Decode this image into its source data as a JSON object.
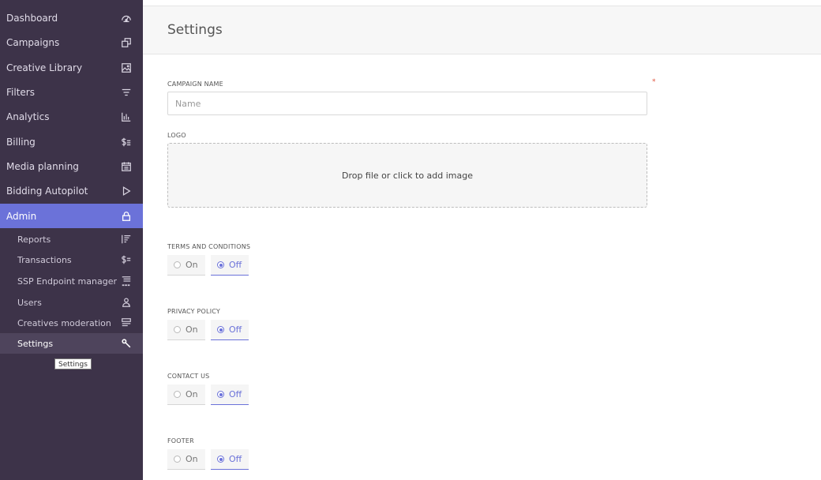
{
  "sidebar": {
    "items": [
      {
        "label": "Dashboard",
        "icon": "dashboard-icon"
      },
      {
        "label": "Campaigns",
        "icon": "campaigns-icon"
      },
      {
        "label": "Creative Library",
        "icon": "image-icon"
      },
      {
        "label": "Filters",
        "icon": "filter-icon"
      },
      {
        "label": "Analytics",
        "icon": "bar-chart-icon"
      },
      {
        "label": "Billing",
        "icon": "billing-icon"
      },
      {
        "label": "Media planning",
        "icon": "calendar-icon"
      },
      {
        "label": "Bidding Autopilot",
        "icon": "play-icon"
      },
      {
        "label": "Admin",
        "icon": "lock-icon",
        "active": true
      }
    ],
    "subitems": [
      {
        "label": "Reports",
        "icon": "reports-icon"
      },
      {
        "label": "Transactions",
        "icon": "transactions-icon"
      },
      {
        "label": "SSP Endpoint manager",
        "icon": "ssp-list-icon"
      },
      {
        "label": "Users",
        "icon": "users-icon"
      },
      {
        "label": "Creatives moderation",
        "icon": "moderation-icon"
      },
      {
        "label": "Settings",
        "icon": "wrench-icon",
        "selected": true
      }
    ],
    "tooltip": "Settings"
  },
  "main": {
    "title": "Settings",
    "campaign_name": {
      "label": "CAMPAIGN NAME",
      "required_mark": "*",
      "placeholder": "Name",
      "value": ""
    },
    "logo": {
      "label": "LOGO",
      "dropzone_text": "Drop file or click to add image"
    },
    "toggles": [
      {
        "label": "TERMS AND CONDITIONS",
        "on_label": "On",
        "off_label": "Off",
        "value": "Off"
      },
      {
        "label": "PRIVACY POLICY",
        "on_label": "On",
        "off_label": "Off",
        "value": "Off"
      },
      {
        "label": "CONTACT US",
        "on_label": "On",
        "off_label": "Off",
        "value": "Off"
      },
      {
        "label": "FOOTER",
        "on_label": "On",
        "off_label": "Off",
        "value": "Off"
      }
    ]
  },
  "colors": {
    "sidebar_bg": "#3d3349",
    "accent": "#6b72d9",
    "required": "#e0533d"
  }
}
